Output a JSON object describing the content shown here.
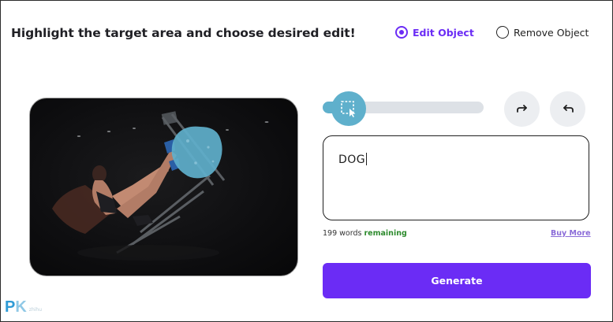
{
  "header": {
    "title": "Highlight the target area and choose desired edit!"
  },
  "mode": {
    "options": [
      {
        "label": "Edit Object",
        "selected": true
      },
      {
        "label": "Remove Object",
        "selected": false
      }
    ],
    "accent_color": "#6b2cf5"
  },
  "canvas": {
    "image": "photo-woman-leg-press-gym",
    "mask_color": "#5fb0cc"
  },
  "brush": {
    "size_level": 0.15,
    "thumb_icon": "selection-cursor-icon"
  },
  "toolbar": {
    "redo_icon": "redo-icon",
    "undo_icon": "undo-icon"
  },
  "prompt": {
    "value": "DOG"
  },
  "counter": {
    "count": "199 words",
    "suffix": "remaining"
  },
  "buy_more_label": "Buy More",
  "generate_label": "Generate",
  "watermark": {
    "logo_p": "P",
    "logo_k": "K",
    "small_text": "zhihu"
  }
}
